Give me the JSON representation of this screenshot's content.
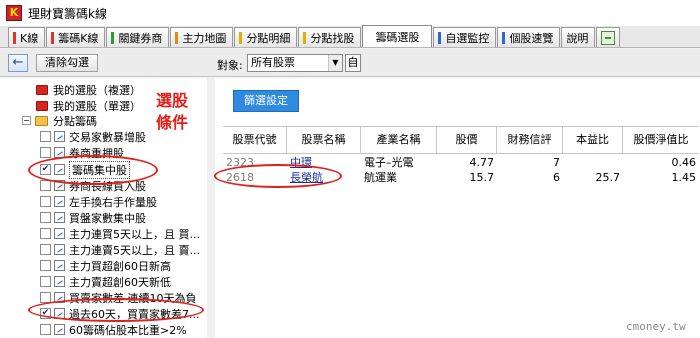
{
  "window": {
    "title": "理財寶籌碼k線"
  },
  "tabs": [
    {
      "label": "K線",
      "color": "#d53a2a"
    },
    {
      "label": "籌碼K線",
      "color": "#d53a2a"
    },
    {
      "label": "關鍵券商",
      "color": "#2c9a3a"
    },
    {
      "label": "主力地圖",
      "color": "#e08a1a"
    },
    {
      "label": "分點明細",
      "color": "#e0b000"
    },
    {
      "label": "分點找股",
      "color": "#e0b000"
    },
    {
      "label": "籌碼選股",
      "color": "",
      "active": true
    },
    {
      "label": "自選監控",
      "color": "#2c6ac8"
    },
    {
      "label": "個股速覽",
      "color": "#2c6ac8"
    },
    {
      "label": "說明",
      "color": ""
    }
  ],
  "toolbar": {
    "back_icon": "arrow-left-icon",
    "clear_label": "清除勾選",
    "target_label": "對象:",
    "target_value": "所有股票",
    "self_label": "自"
  },
  "tree": {
    "items": [
      {
        "label": "我的選股（複選）",
        "type": "folder-red"
      },
      {
        "label": "我的選股（單選）",
        "type": "folder-red"
      },
      {
        "label": "分點籌碼",
        "type": "folder-yellow",
        "expanded": true
      },
      {
        "label": "交易家數暴增股",
        "checked": false
      },
      {
        "label": "券商重押股",
        "checked": false
      },
      {
        "label": "籌碼集中股",
        "checked": true,
        "selected": true
      },
      {
        "label": "券商長線買入股",
        "checked": false
      },
      {
        "label": "左手換右手作量股",
        "checked": false
      },
      {
        "label": "買盤家數集中股",
        "checked": false
      },
      {
        "label": "主力連買5天以上，且 買...",
        "checked": false
      },
      {
        "label": "主力連賣5天以上，且 賣...",
        "checked": false
      },
      {
        "label": "主力買超創60日新高",
        "checked": false
      },
      {
        "label": "主力賣超創60天新低",
        "checked": false
      },
      {
        "label": "買賣家數差 連續10天為負",
        "checked": false
      },
      {
        "label": "過去60天，買賣家數差7...",
        "checked": true
      },
      {
        "label": "60籌碼佔股本比重>2%",
        "checked": false
      }
    ]
  },
  "annotation": {
    "text": "選股條件",
    "color": "#e0201a"
  },
  "results": {
    "filter_button": "篩選設定",
    "columns": [
      "股票代號",
      "股票名稱",
      "產業名稱",
      "股價",
      "財務信評",
      "本益比",
      "股價淨值比"
    ],
    "rows": [
      {
        "code": "2323",
        "name": "中環",
        "industry": "電子–光電",
        "price": "4.77",
        "rating": "7",
        "pe": "",
        "pb": "0.46"
      },
      {
        "code": "2618",
        "name": "長榮航",
        "industry": "航運業",
        "price": "15.7",
        "rating": "6",
        "pe": "25.7",
        "pb": "1.45"
      }
    ]
  },
  "watermark": "cmoney.tw"
}
